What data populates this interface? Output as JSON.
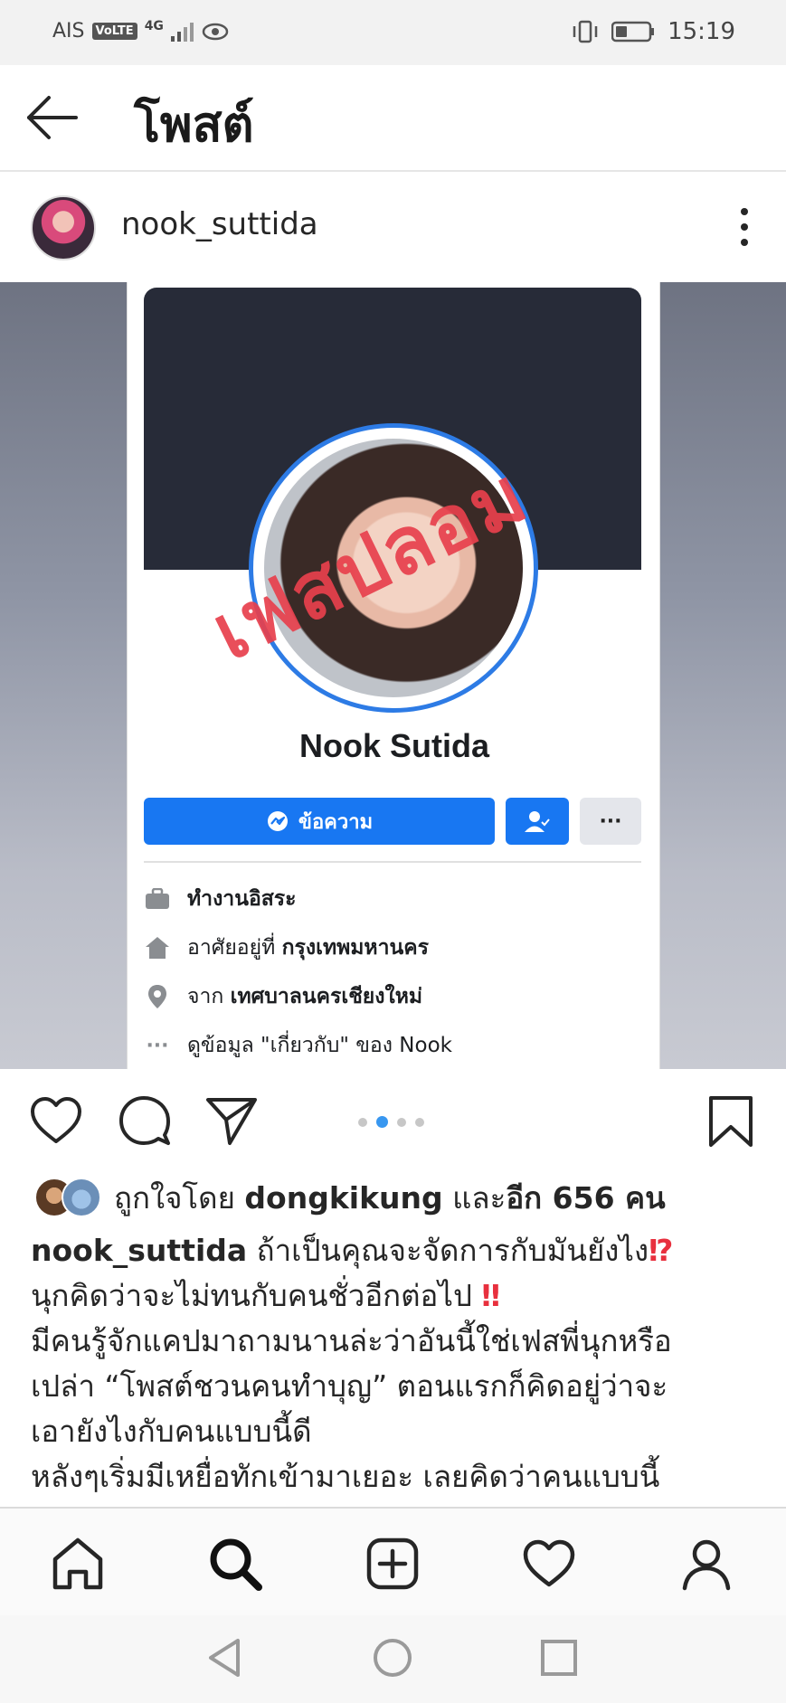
{
  "status_bar": {
    "carrier": "AIS",
    "volte": "VoLTE",
    "network": "4G",
    "time": "15:19"
  },
  "header": {
    "title": "โพสต์"
  },
  "post": {
    "username": "nook_suttida"
  },
  "media": {
    "stamp_text": "เฟสปลอม",
    "profile_name": "Nook Sutida",
    "message_button": "ข้อความ",
    "more_button": "···",
    "info": {
      "work": "ทำงานอิสระ",
      "lives_prefix": "อาศัยอยู่ที่ ",
      "lives_city": "กรุงเทพมหานคร",
      "from_prefix": "จาก ",
      "from_city": "เทศบาลนครเชียงใหม่",
      "about_link": "ดูข้อมูล \"เกี่ยวกับ\" ของ Nook"
    }
  },
  "carousel": {
    "count": 4,
    "active": 2
  },
  "likes": {
    "prefix": "ถูกใจโดย ",
    "user": "dongkikung",
    "middle": " และ",
    "others": "อีก 656 คน"
  },
  "caption": {
    "username": "nook_suttida",
    "line1": " ถ้าเป็นคุณจะจัดการกับมันยังไง",
    "line1_emoji": "⁉",
    "line2": "นุกคิดว่าจะไม่ทนกับคนชั่วอีกต่อไป",
    "line2_emoji": "‼",
    "line3": "มีคนรู้จักแคปมาถามนานล่ะว่าอันนี้ใช่เฟสพี่นุกหรือ",
    "line4": "เปล่า “โพสต์ชวนคนทำบุญ” ตอนแรกก็คิดอยู่ว่าจะ",
    "line5": "เอายังไงกับคนแบบนี้ดี",
    "line6": "หลังๆเริ่มมีเหยื่อทักเข้ามาเยอะ เลยคิดว่าคนแบบนี้"
  },
  "icons": {
    "back": "arrow-left-icon",
    "like": "heart-icon",
    "comment": "comment-icon",
    "share": "send-icon",
    "save": "bookmark-icon"
  },
  "colors": {
    "facebook_blue": "#1877f2",
    "stamp_red": "#e8404d",
    "carousel_active": "#3897f0"
  }
}
